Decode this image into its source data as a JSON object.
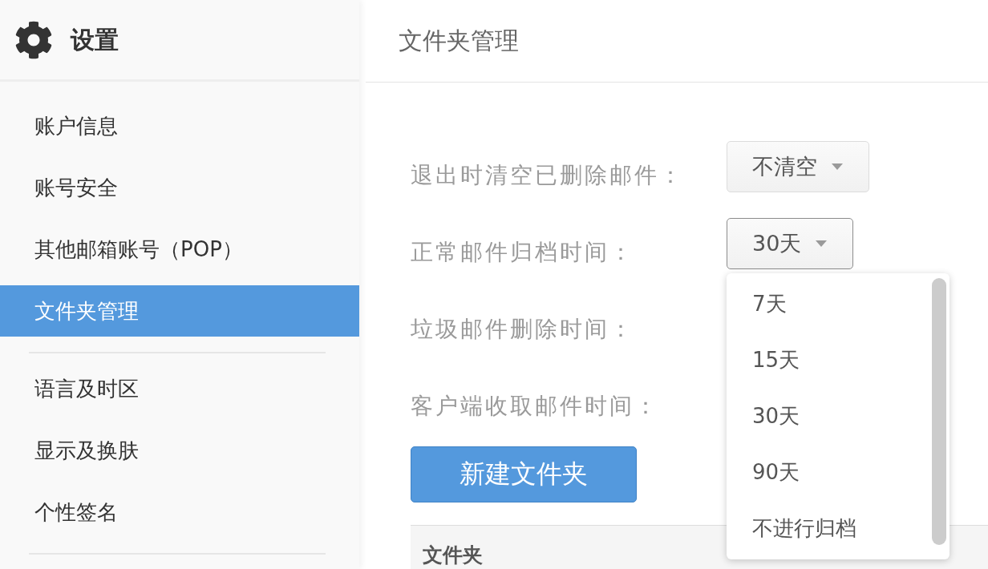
{
  "sidebar": {
    "title": "设置",
    "sections": [
      {
        "items": [
          {
            "label": "账户信息",
            "selected": false
          },
          {
            "label": "账号安全",
            "selected": false
          },
          {
            "label": "其他邮箱账号（POP）",
            "selected": false
          },
          {
            "label": "文件夹管理",
            "selected": true
          }
        ]
      },
      {
        "items": [
          {
            "label": "语言及时区",
            "selected": false
          },
          {
            "label": "显示及换肤",
            "selected": false
          },
          {
            "label": "个性签名",
            "selected": false
          }
        ]
      }
    ]
  },
  "main": {
    "title": "文件夹管理",
    "settings": [
      {
        "label": "退出时清空已删除邮件：",
        "value": "不清空",
        "expanded": false
      },
      {
        "label": "正常邮件归档时间：",
        "value": "30天",
        "expanded": true,
        "options": [
          "7天",
          "15天",
          "30天",
          "90天",
          "不进行归档"
        ]
      },
      {
        "label": "垃圾邮件删除时间："
      },
      {
        "label": "客户端收取邮件时间："
      }
    ],
    "new_folder_button": "新建文件夹",
    "table": {
      "columns": [
        "文件夹"
      ]
    }
  }
}
